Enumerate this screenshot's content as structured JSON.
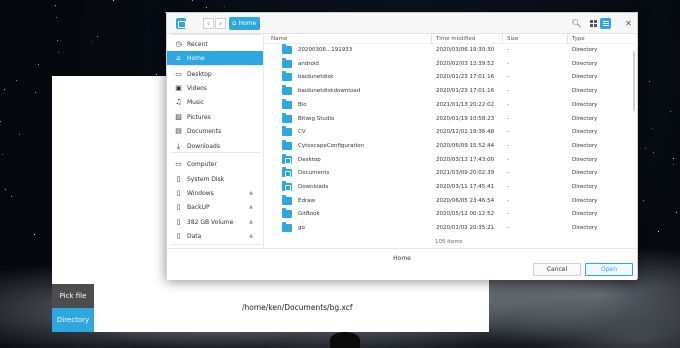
{
  "colors": {
    "accent": "#2ca7e0",
    "pick_button_bg": "#4d4d4d",
    "desktop": "#05080d"
  },
  "app": {
    "pick_file_label": "Pick file",
    "directory_label": "Directory",
    "selected_path": "/home/ken/Documents/bg.xcf"
  },
  "dialog": {
    "breadcrumb": "Home",
    "nav": {
      "back": "‹",
      "forward": "›"
    },
    "toolbar": {
      "search_icon": "search-icon",
      "grid_icon": "grid-view-icon",
      "list_icon": "list-view-icon",
      "close": "✕"
    },
    "sidebar": [
      {
        "label": "Recent",
        "icon": "clock-icon",
        "glyph": "◷"
      },
      {
        "label": "Home",
        "icon": "home-icon",
        "glyph": "⌂"
      },
      {
        "label": "Desktop",
        "icon": "desktop-icon",
        "glyph": "▭"
      },
      {
        "label": "Videos",
        "icon": "video-icon",
        "glyph": "▣"
      },
      {
        "label": "Music",
        "icon": "music-icon",
        "glyph": "♫"
      },
      {
        "label": "Pictures",
        "icon": "picture-icon",
        "glyph": "▨"
      },
      {
        "label": "Documents",
        "icon": "document-icon",
        "glyph": "▤"
      },
      {
        "label": "Downloads",
        "icon": "download-icon",
        "glyph": "⤓"
      },
      {
        "label": "Computer",
        "icon": "computer-icon",
        "glyph": "▭"
      },
      {
        "label": "System Disk",
        "icon": "disk-icon",
        "glyph": "▯"
      },
      {
        "label": "Windows",
        "icon": "disk-icon",
        "glyph": "▯"
      },
      {
        "label": "BackUP",
        "icon": "disk-icon",
        "glyph": "▯"
      },
      {
        "label": "382 GB Volume",
        "icon": "disk-icon",
        "glyph": "▯"
      },
      {
        "label": "Data",
        "icon": "disk-icon",
        "glyph": "▯"
      }
    ],
    "eject_glyph": "▲",
    "columns": {
      "name": "Name",
      "modified": "Time modified",
      "size": "Size",
      "type": "Type"
    },
    "files": [
      {
        "name": "20200306...191933",
        "modified": "2020/03/06 19:30:30",
        "size": "-",
        "type": "Directory"
      },
      {
        "name": "android",
        "modified": "2020/02/03 12:39:52",
        "size": "-",
        "type": "Directory"
      },
      {
        "name": "baidunetdisk",
        "modified": "2020/01/23 17:01:16",
        "size": "-",
        "type": "Directory"
      },
      {
        "name": "baidunetdiskdownload",
        "modified": "2020/01/23 17:01:16",
        "size": "-",
        "type": "Directory"
      },
      {
        "name": "Bio",
        "modified": "2021/01/13 20:22:02",
        "size": "-",
        "type": "Directory"
      },
      {
        "name": "Bitwig Studio",
        "modified": "2020/01/19 10:58:23",
        "size": "-",
        "type": "Directory"
      },
      {
        "name": "CV",
        "modified": "2020/12/01 19:36:48",
        "size": "-",
        "type": "Directory"
      },
      {
        "name": "CytoscapeConfiguration",
        "modified": "2020/06/09 15:52:44",
        "size": "-",
        "type": "Directory"
      },
      {
        "name": "Desktop",
        "modified": "2020/03/12 17:43:00",
        "size": "-",
        "type": "Directory"
      },
      {
        "name": "Documents",
        "modified": "2021/03/09 20:02:39",
        "size": "-",
        "type": "Directory"
      },
      {
        "name": "Downloads",
        "modified": "2020/03/11 17:45:41",
        "size": "-",
        "type": "Directory"
      },
      {
        "name": "Edraw",
        "modified": "2020/06/05 23:46:54",
        "size": "-",
        "type": "Directory"
      },
      {
        "name": "GitBook",
        "modified": "2020/05/12 00:12:52",
        "size": "-",
        "type": "Directory"
      },
      {
        "name": "go",
        "modified": "2020/01/02 20:35:21",
        "size": "-",
        "type": "Directory"
      }
    ],
    "item_count": "105 items",
    "current_name": "Home",
    "cancel_label": "Cancel",
    "open_label": "Open"
  }
}
